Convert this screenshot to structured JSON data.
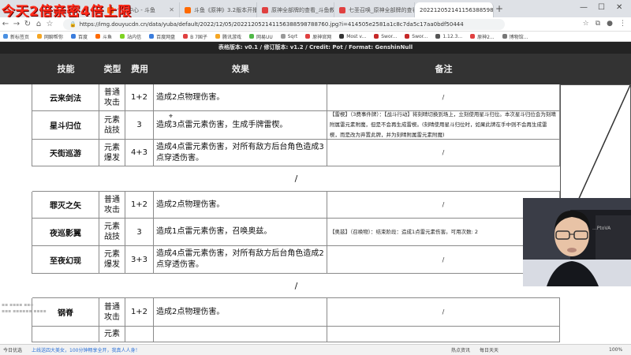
{
  "overlay_title": "今天2倍亲密4倍上限",
  "browser": {
    "tabs": [
      {
        "label": "个人中心 - 斗鱼",
        "active": false
      },
      {
        "label": "斗鱼《原神》3.2版本开播前瞻",
        "active": false
      },
      {
        "label": "原神全部牌的查看_斗鱼教程",
        "active": false
      },
      {
        "label": "七圣召唤_原神全部牌的查看_斗",
        "active": false
      },
      {
        "label": "20221205214115638859878",
        "active": true
      }
    ],
    "url": "https://img.douyucdn.cn/data/yuba/default/2022/12/05/202212052141156388598788760.jpg?i=414505e2581a1c8c7da5c17aa0bdf50444",
    "bookmarks": [
      "新标签页",
      "网聊帮你",
      "百度",
      "斗鱼",
      "站内信",
      "百度网盘",
      "B 7国子",
      "腾讯游戏",
      "网易UU",
      "Sqrt",
      "原神官网",
      "Most v...",
      "Swor...",
      "Swor...",
      "1.12.3...",
      "原神2...",
      "博物馆..."
    ]
  },
  "table": {
    "banner": "表格版本: v0.1 / 修订版本: v1.2 / Credit: Pot / Format: GenshinNull",
    "headers": {
      "skill": "技能",
      "type": "类型",
      "cost": "费用",
      "effect": "效果",
      "note": "备注"
    },
    "rows": [
      {
        "skill": "云来剑法",
        "type": "普通\n攻击",
        "cost": "1+2",
        "effect": "造成2点物理伤害。",
        "note": "/"
      },
      {
        "skill": "星斗归位",
        "type": "元素\n战技",
        "cost": "3",
        "effect": "造成3点雷元素伤害，生成手牌雷楔。",
        "note": "【雷楔】（3费事件牌）：【战斗行动】将刻晴切换到场上，立刻使用星斗归位。本次星斗归位会为刻晴附属雷元素附魔，但是不会再生成雷楔。(刻晴使用星斗归位时，如果此牌在手中则不会再生成雷楔，而是改为弃置此牌，并为刻晴附属雷元素附魔)"
      },
      {
        "skill": "天街巡游",
        "type": "元素\n爆发",
        "cost": "4+3",
        "effect": "造成4点雷元素伤害，对所有敌方后台角色造成3点穿透伤害。",
        "note": "/"
      },
      {
        "spacer": "/"
      },
      {
        "skill": "罪灭之矢",
        "type": "普通\n攻击",
        "cost": "1+2",
        "effect": "造成2点物理伤害。",
        "note": "/"
      },
      {
        "skill": "夜巡影翼",
        "type": "元素\n战技",
        "cost": "3",
        "effect": "造成1点雷元素伤害，召唤奥兹。",
        "note": "【奥兹】（召唤物）：结束阶段：造成1点雷元素伤害。可用次数: 2"
      },
      {
        "skill": "至夜幻现",
        "type": "元素\n爆发",
        "cost": "3+3",
        "effect": "造成4点雷元素伤害，对所有敌方后台角色造成2点穿透伤害。",
        "note": "/"
      },
      {
        "spacer": "/"
      },
      {
        "skill": "钢脊",
        "type": "普通\n攻击",
        "cost": "1+2",
        "effect": "造成2点物理伤害。",
        "note": "/"
      },
      {
        "skill": "",
        "type": "元素",
        "cost": "",
        "effect": "",
        "note": ""
      }
    ]
  },
  "webcam": {
    "chair_label": "...PtoVA"
  },
  "statusbar": {
    "left": "今日优选",
    "news": "上线送四大美女，100分钟畅享全开，我真人人身！",
    "items": [
      "热点资讯",
      "每日天天",
      "100%"
    ]
  },
  "colors": {
    "header_bg": "#333333",
    "banner_bg": "#232323",
    "overlay_red": "#ff2a1a",
    "tab_strip": "#dee1e6"
  }
}
